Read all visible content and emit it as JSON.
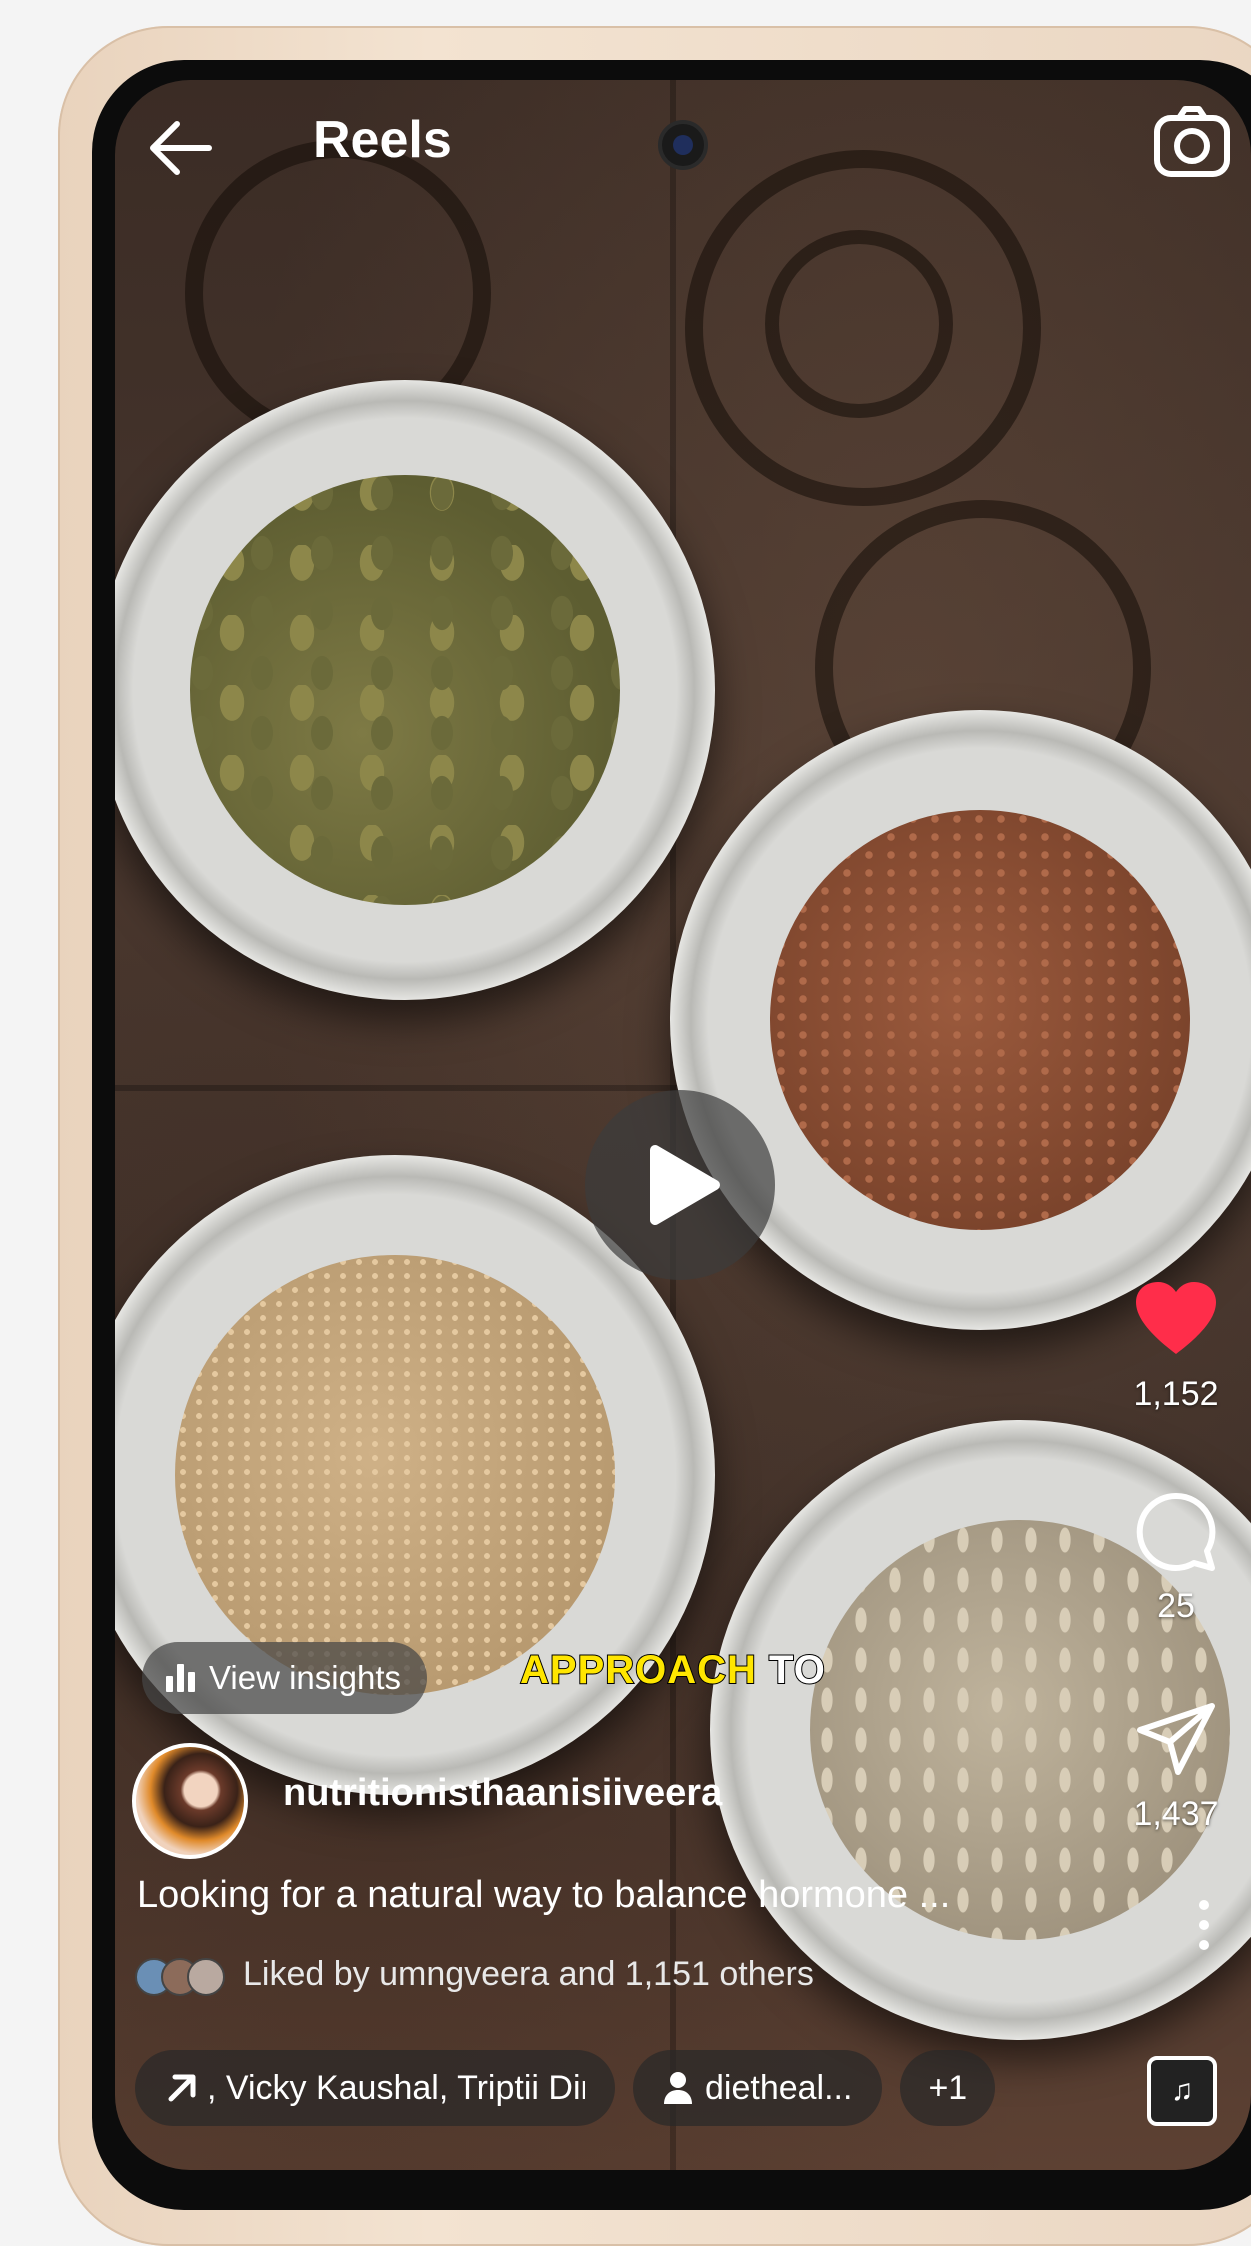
{
  "header": {
    "title": "Reels",
    "back_icon": "arrow-left-icon",
    "camera_icon": "camera-icon"
  },
  "video": {
    "play_icon": "play-icon",
    "caption_highlight": "APPROACH",
    "caption_rest": " TO",
    "caption_highlight_color": "#ffe600"
  },
  "actions": {
    "like_count": "1,152",
    "comment_count": "25",
    "share_count": "1,437",
    "like_color": "#ff2d4a"
  },
  "insights_label": "View insights",
  "post": {
    "username": "nutritionisthaanisiiveera",
    "description": "Looking for a natural way to balance hormone ...",
    "liked_by": "Liked by umngveera and 1,151 others"
  },
  "tags": {
    "collab": ", Vicky Kaushal, Triptii Dimi",
    "person": "dietheal...",
    "more": "+1"
  }
}
